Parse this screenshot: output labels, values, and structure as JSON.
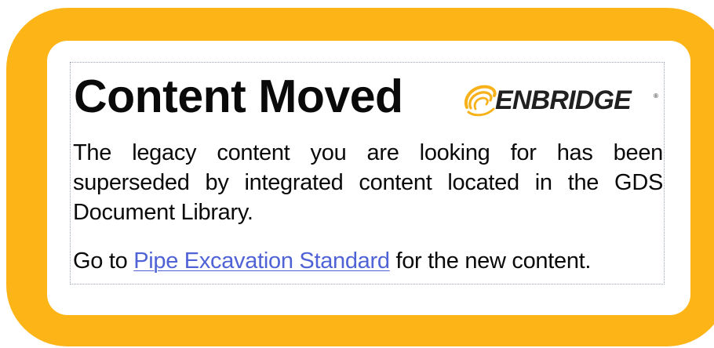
{
  "notice": {
    "title": "Content Moved",
    "logo_text": "ENBRIDGE",
    "logo_trademark": "®",
    "message": "The legacy content you are looking for has been superseded by integrated content located in the GDS Document Library.",
    "goto_prefix": "Go to ",
    "link_text": "Pipe Excavation Standard",
    "goto_suffix": " for the new content."
  },
  "colors": {
    "frame": "#fdb417",
    "panel": "#ffffff",
    "text": "#0a0a0a",
    "link": "#4f63d6",
    "logo_swoosh": "#f7b21b"
  },
  "icons": {
    "logo": "enbridge-swoosh-icon"
  }
}
